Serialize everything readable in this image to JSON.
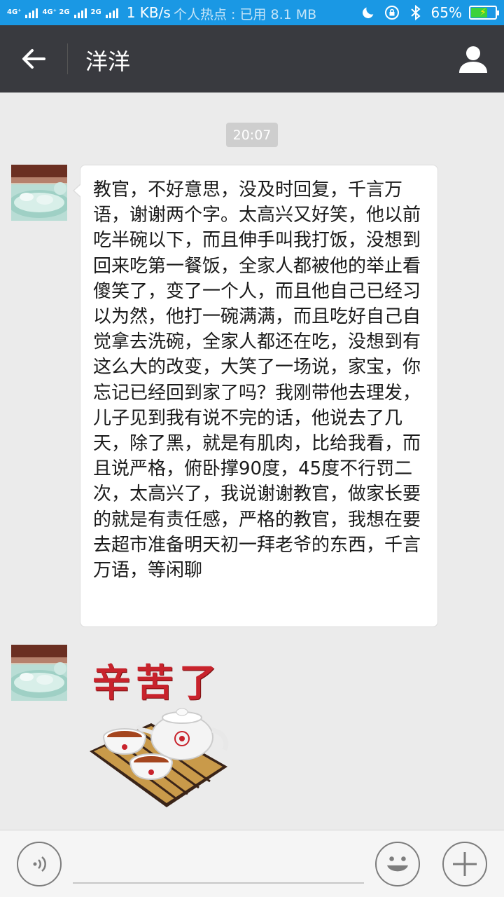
{
  "status_bar": {
    "network_1": "4G⁺",
    "network_2": "4G⁺ 2G",
    "network_3": "2G",
    "speed": "1 KB/s",
    "hotspot": "个人热点 : 已用 8.1 MB",
    "battery_text": "65%",
    "battery_level": 0.65,
    "icons": [
      "moon-icon",
      "rotation-lock-icon",
      "bluetooth-icon",
      "battery-icon"
    ]
  },
  "header": {
    "title": "洋洋",
    "back_icon": "back-arrow-icon",
    "profile_icon": "user-profile-icon"
  },
  "conversation": {
    "timestamp": "20:07",
    "messages": [
      {
        "type": "text",
        "text": "教官，不好意思，没及时回复，千言万语，谢谢两个字。太高兴又好笑，他以前吃半碗以下，而且伸手叫我打饭，没想到回来吃第一餐饭，全家人都被他的举止看傻笑了，变了一个人，而且他自己已经习以为然，他打一碗满满，而且吃好自己自觉拿去洗碗，全家人都还在吃，没想到有这么大的改变，大笑了一场说，家宝，你忘记已经回到家了吗？我刚带他去理发，儿子见到我有说不完的话，他说去了几天，除了黑，就是有肌肉，比给我看，而且说严格，俯卧撑90度，45度不行罚二次，太高兴了，我说谢谢教官，做家长要的就是有责任感，严格的教官，我想在要去超市准备明天初一拜老爷的东西，千言万语，等闲聊"
      },
      {
        "type": "sticker",
        "sticker_text": "辛苦了"
      }
    ]
  },
  "input_bar": {
    "voice_icon": "voice-icon",
    "emoji_icon": "emoji-icon",
    "more_icon": "plus-icon",
    "placeholder": ""
  },
  "colors": {
    "status_bar": "#1a98e4",
    "title_bar": "#393a3f",
    "chat_bg": "#ebebeb",
    "bubble": "#ffffff",
    "sticker_red": "#c8232c"
  }
}
